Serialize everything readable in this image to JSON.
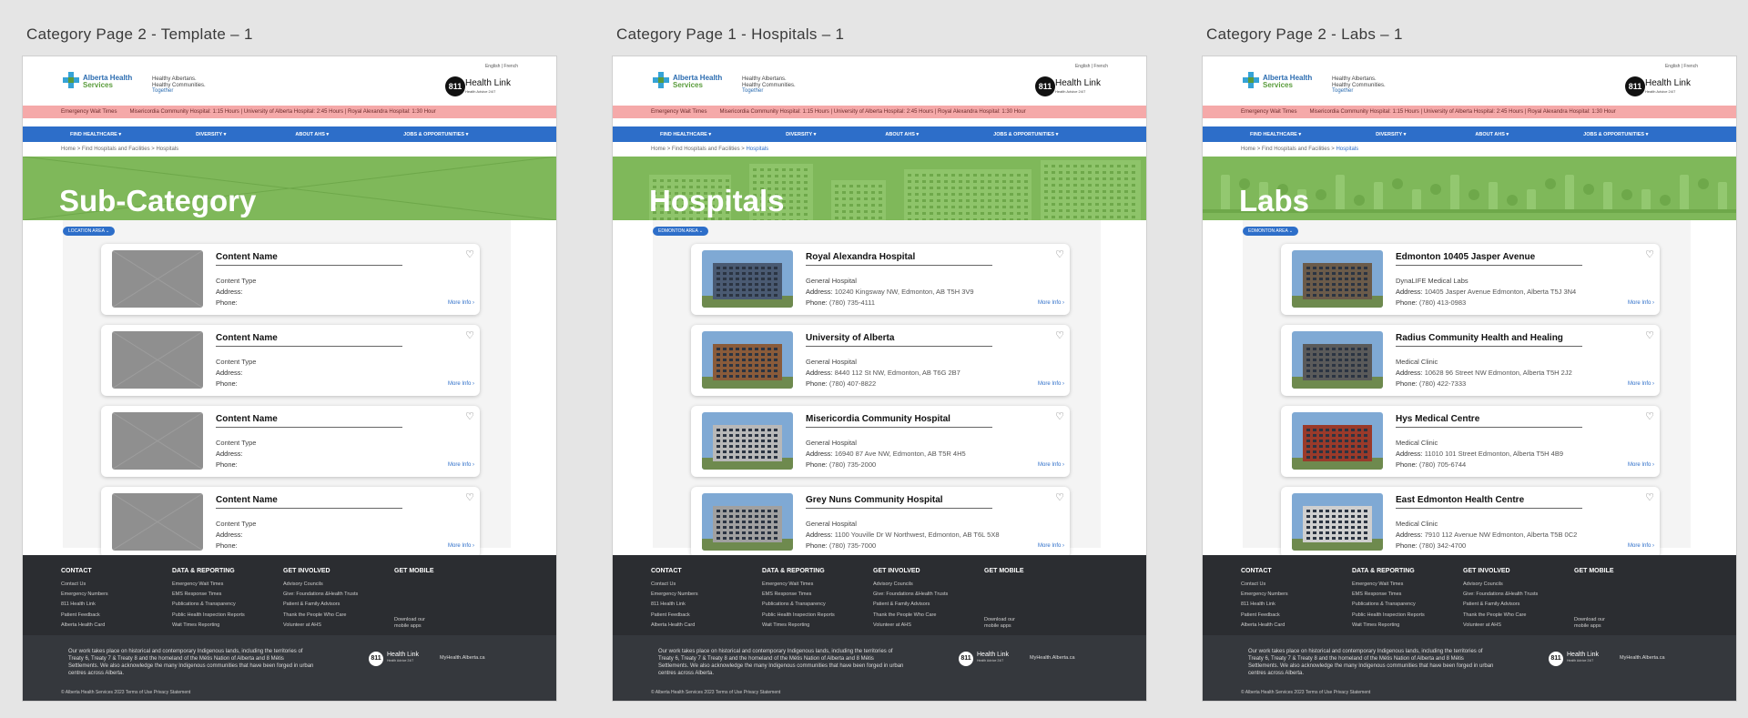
{
  "frame_titles": [
    "Category Page 2 - Template – 1",
    "Category Page 1 - Hospitals – 1",
    "Category Page 2 - Labs – 1"
  ],
  "header": {
    "lang": "English | French",
    "org_line1": "Alberta Health",
    "org_line2": "Services",
    "tag1": "Healthy Albertans.",
    "tag2": "Healthy Communities.",
    "tag3": "Together",
    "hl_num": "811",
    "hl_title": "Health Link",
    "hl_sub": "Health Advice 24/7"
  },
  "alert": {
    "label": "Emergency Wait Times",
    "text": "Misericordia Community Hospital: 1:15 Hours | University of Alberta Hospital: 2:45 Hours | Royal Alexandra Hospital: 1:30 Hour"
  },
  "nav": [
    "FIND HEALTHCARE ▾",
    "DIVERSITY ▾",
    "ABOUT AHS ▾",
    "JOBS & OPPORTUNITIES ▾"
  ],
  "breadcrumb": {
    "home": "Home",
    "sep1": ">",
    "parent": "Find Hospitals and Facilities",
    "sep2": ">",
    "current": "Hospitals"
  },
  "labels": {
    "address": "Address:",
    "phone": "Phone:",
    "more": "More Info ›",
    "heart": "♡"
  },
  "pages": [
    {
      "hero": "Sub-Category",
      "filter": "LOCATION AREA ⌄",
      "cards": [
        {
          "name": "Content Name",
          "type": "Content Type",
          "address": "",
          "phone": ""
        },
        {
          "name": "Content Name",
          "type": "Content Type",
          "address": "",
          "phone": ""
        },
        {
          "name": "Content Name",
          "type": "Content Type",
          "address": "",
          "phone": ""
        },
        {
          "name": "Content Name",
          "type": "Content Type",
          "address": "",
          "phone": ""
        }
      ]
    },
    {
      "hero": "Hospitals",
      "filter": "EDMONTON AREA ⌄",
      "cards": [
        {
          "name": "Royal Alexandra Hospital",
          "type": "General Hospital",
          "address": "10240 Kingsway NW, Edmonton, AB T5H 3V9",
          "phone": "(780) 735-4111"
        },
        {
          "name": "University of Alberta",
          "type": "General Hospital",
          "address": "8440 112 St NW, Edmonton, AB T6G 2B7",
          "phone": "(780) 407-8822"
        },
        {
          "name": "Misericordia Community Hospital",
          "type": "General Hospital",
          "address": "16940 87 Ave NW, Edmonton, AB T5R 4H5",
          "phone": "(780) 735-2000"
        },
        {
          "name": "Grey Nuns Community Hospital",
          "type": "General Hospital",
          "address": "1100 Youville Dr W Northwest, Edmonton, AB T6L 5X8",
          "phone": "(780) 735-7000"
        }
      ]
    },
    {
      "hero": "Labs",
      "filter": "EDMONTON AREA ⌄",
      "cards": [
        {
          "name": "Edmonton 10405 Jasper Avenue",
          "type": "DynaLIFE Medical Labs",
          "address": "10405 Jasper Avenue Edmonton, Alberta T5J 3N4",
          "phone": "(780) 413-0983"
        },
        {
          "name": "Radius Community Health and Healing",
          "type": "Medical Clinic",
          "address": "10628 96 Street NW Edmonton, Alberta T5H 2J2",
          "phone": "(780) 422-7333"
        },
        {
          "name": "Hys Medical Centre",
          "type": "Medical Clinic",
          "address": "11010 101 Street Edmonton, Alberta T5H 4B9",
          "phone": "(780) 705-6744"
        },
        {
          "name": "East Edmonton Health Centre",
          "type": "Medical Clinic",
          "address": "7910 112 Avenue NW Edmonton, Alberta T5B 0C2",
          "phone": "(780) 342-4700"
        }
      ]
    }
  ],
  "footer": {
    "cols": [
      {
        "title": "CONTACT",
        "links": [
          "Contact Us",
          "Emergency Numbers",
          "811 Health Link",
          "Patient Feedback",
          "Alberta Health Card"
        ]
      },
      {
        "title": "DATA & REPORTING",
        "links": [
          "Emergency Wait Times",
          "EMS Response Times",
          "Publications & Transparency",
          "Public Health Inspection Reports",
          "Wait Times Reporting"
        ]
      },
      {
        "title": "GET INVOLVED",
        "links": [
          "Advisory Councils",
          "Give: Foundations &Health Trusts",
          "Patient & Family Advisors",
          "Thank the People Who Care",
          "Volunteer at AHS"
        ]
      },
      {
        "title": "GET MOBILE",
        "links": []
      }
    ],
    "download1": "Download our",
    "download2": "mobile apps",
    "land": "Our work takes place on historical and contemporary Indigenous lands, including the territories of Treaty 6, Treaty 7 & Treaty 8 and the homeland of the Métis Nation of Alberta and 8 Métis Settlements. We also acknowledge the many Indigenous communities that have been forged in urban centres across Alberta.",
    "hl_num": "811",
    "hl_title": "Health Link",
    "hl_sub": "Health Advice 24/7",
    "myhealth": "MyHealth.Alberta.ca",
    "copyright": "© Alberta Health Services 2023 Terms of Use Privacy Statement"
  },
  "colors": {
    "nav": "#2d6ec9",
    "alert": "#f5a9a9",
    "hero": "#7fb85a",
    "footer": "#2b2d31"
  }
}
